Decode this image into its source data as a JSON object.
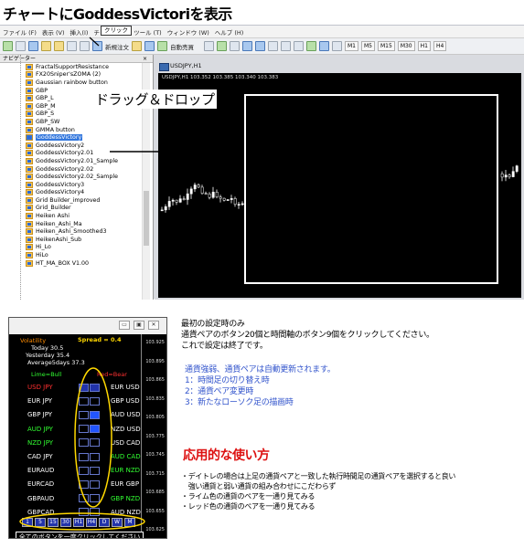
{
  "title": "チャートにGoddessVictoriを表示",
  "menu": [
    "ファイル (F)",
    "表示 (V)",
    "挿入(I)",
    "チャート (C)",
    "ツール (T)",
    "ウィンドウ (W)",
    "ヘルプ (H)"
  ],
  "toolbar": {
    "new_order": "新規注文",
    "auto_trade": "自動売買",
    "timeframes": [
      "M1",
      "M5",
      "M15",
      "M30",
      "H1",
      "H4"
    ]
  },
  "tooltip": "クリック",
  "navigator": {
    "title": "ナビゲーター",
    "close": "×",
    "items": [
      "FractalSupportResistance",
      "FX20Sniper'sZOMA (2)",
      "Gaussian rainbow button",
      "GBP",
      "GBP_L",
      "GBP_M",
      "GBP_S",
      "GBP_SW",
      "GMMA button",
      "GoddessVictory",
      "GoddessVictory2",
      "GoddessVictory2.01",
      "GoddessVictory2.01_Sample",
      "GoddessVictory2.02",
      "GoddessVictory2.02_Sample",
      "GoddessVictory3",
      "GoddessVictory4",
      "Grid Builder_improved",
      "Grid_Builder",
      "Heiken Ashi",
      "Heiken_Ashi_Ma",
      "Heiken_Ashi_Smoothed3",
      "HeikenAshi_Sub",
      "Hi_Lo",
      "HiLo",
      "HT_MA_BOX V1.00"
    ],
    "selected_index": 9
  },
  "chart": {
    "tab": "USDJPY,H1",
    "info": "USDJPY,H1  103.352 103.385 103.340 103.383"
  },
  "drag_drop_label": "ドラッグ＆ドロップ",
  "panel": {
    "win_buttons": [
      "▭",
      "▣",
      "✕"
    ],
    "volatility": "Volatility",
    "spread": "Spread = 0.4",
    "today": "Today  30.5",
    "yesterday": "Yesterday  35.4",
    "average": "Average5days  37.3",
    "lime": "Lime=Bull",
    "red": "Red=Bear",
    "left_pairs": [
      "USD JPY",
      "EUR JPY",
      "GBP JPY",
      "AUD JPY",
      "NZD JPY",
      "CAD JPY",
      "EURAUD",
      "EURCAD",
      "GBPAUD",
      "GBPCAD"
    ],
    "right_pairs": [
      "EUR USD",
      "GBP USD",
      "AUD USD",
      "NZD USD",
      "USD CAD",
      "AUD CAD",
      "EUR NZD",
      "EUR GBP",
      "GBP NZD",
      "AUD NZD"
    ],
    "timeframes": [
      "1",
      "5",
      "15",
      "30",
      "H1",
      "H4",
      "D",
      "W",
      "M"
    ],
    "all_button_note": "全てのボタンを一度クリックしてください",
    "price_ticks": [
      "103.925",
      "103.895",
      "103.865",
      "103.835",
      "103.805",
      "103.775",
      "103.745",
      "103.715",
      "103.685",
      "103.655",
      "103.625"
    ]
  },
  "instructions": {
    "line1": "最初の設定時のみ",
    "line2": "通貨ペアのボタン20個と時間軸のボタン9個をクリックしてください。",
    "line3": "これで設定は終了です。",
    "blue1": "通貨強弱、通貨ペアは自動更新されます。",
    "blue2": "1：時間足の切り替え時",
    "blue3": "2：通貨ペア変更時",
    "blue4": "3：新たなローソク足の描画時",
    "apply_heading": "応用的な使い方",
    "b1": "・デイトレの場合は上足の通貨ペアと一致した執行時間足の通貨ペアを選択すると良い",
    "b2": "　強い通貨と弱い通貨の組み合わせにこだわらず",
    "b3": "・ライム色の通貨のペアを一通り見てみる",
    "b4": "・レッド色の通貨のペアを一通り見てみる"
  }
}
